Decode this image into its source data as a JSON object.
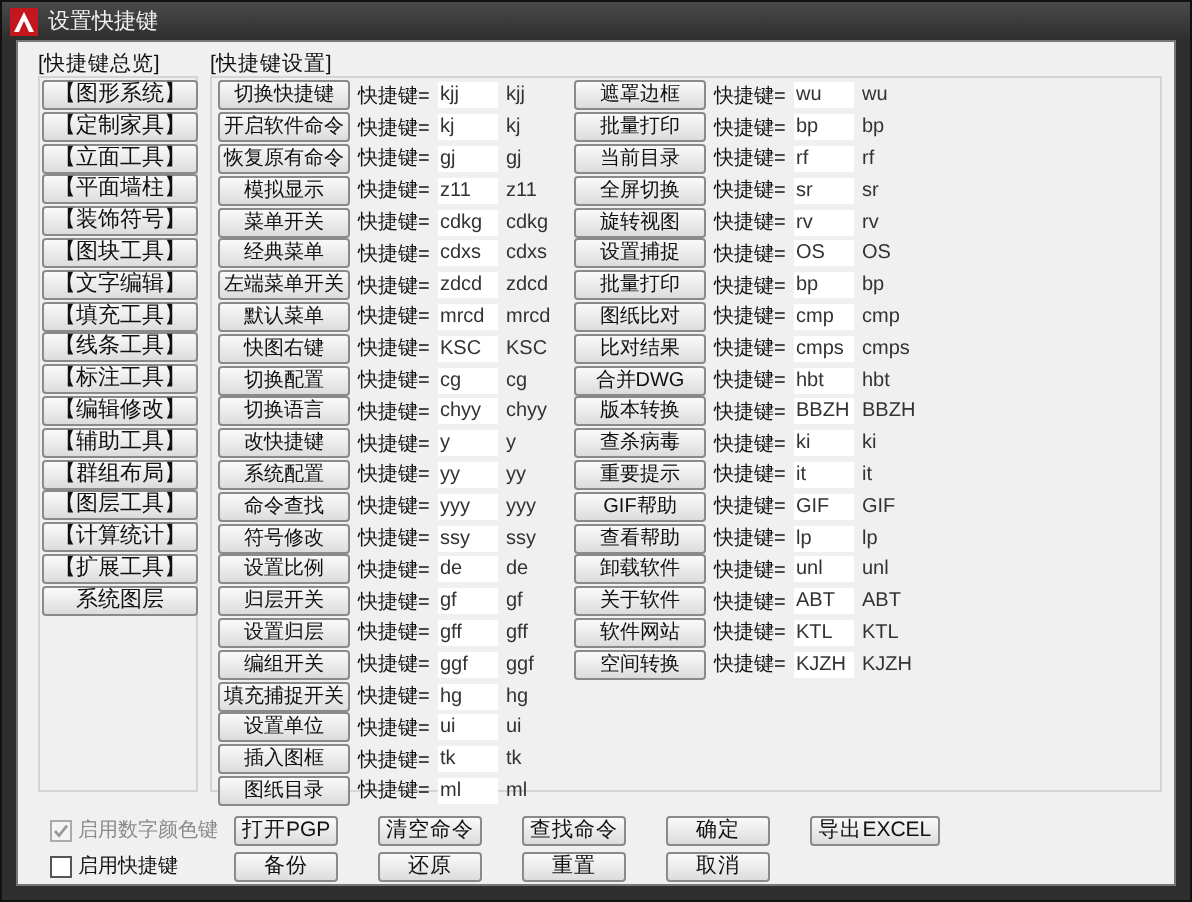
{
  "window": {
    "title": "设置快捷键"
  },
  "overview": {
    "title": "[快捷键总览]",
    "items": [
      {
        "label": "【图形系统】"
      },
      {
        "label": "【定制家具】"
      },
      {
        "label": "【立面工具】"
      },
      {
        "label": "【平面墙柱】"
      },
      {
        "label": "【装饰符号】"
      },
      {
        "label": "【图块工具】"
      },
      {
        "label": "【文字编辑】"
      },
      {
        "label": "【填充工具】"
      },
      {
        "label": "【线条工具】"
      },
      {
        "label": "【标注工具】"
      },
      {
        "label": "【编辑修改】"
      },
      {
        "label": "【辅助工具】"
      },
      {
        "label": "【群组布局】"
      },
      {
        "label": "【图层工具】"
      },
      {
        "label": "【计算统计】"
      },
      {
        "label": "【扩展工具】"
      },
      {
        "label": "系统图层"
      }
    ]
  },
  "settings": {
    "title": "[快捷键设置]",
    "columns": [
      [
        {
          "button": "切换快捷键",
          "label": "快捷键=",
          "value": "kjj",
          "shortcut": "kjj"
        },
        {
          "button": "开启软件命令",
          "label": "快捷键=",
          "value": "kj",
          "shortcut": "kj"
        },
        {
          "button": "恢复原有命令",
          "label": "快捷键=",
          "value": "gj",
          "shortcut": "gj"
        },
        {
          "button": "模拟显示",
          "label": "快捷键=",
          "value": "z11",
          "shortcut": "z11"
        },
        {
          "button": "菜单开关",
          "label": "快捷键=",
          "value": "cdkg",
          "shortcut": "cdkg"
        },
        {
          "button": "经典菜单",
          "label": "快捷键=",
          "value": "cdxs",
          "shortcut": "cdxs"
        },
        {
          "button": "左端菜单开关",
          "label": "快捷键=",
          "value": "zdcd",
          "shortcut": "zdcd"
        },
        {
          "button": "默认菜单",
          "label": "快捷键=",
          "value": "mrcd",
          "shortcut": "mrcd"
        },
        {
          "button": "快图右键",
          "label": "快捷键=",
          "value": "KSC",
          "shortcut": "KSC"
        },
        {
          "button": "切换配置",
          "label": "快捷键=",
          "value": "cg",
          "shortcut": "cg"
        },
        {
          "button": "切换语言",
          "label": "快捷键=",
          "value": "chyy",
          "shortcut": "chyy"
        },
        {
          "button": "改快捷键",
          "label": "快捷键=",
          "value": "y",
          "shortcut": "y"
        },
        {
          "button": "系统配置",
          "label": "快捷键=",
          "value": "yy",
          "shortcut": "yy"
        },
        {
          "button": "命令查找",
          "label": "快捷键=",
          "value": "yyy",
          "shortcut": "yyy"
        },
        {
          "button": "符号修改",
          "label": "快捷键=",
          "value": "ssy",
          "shortcut": "ssy"
        },
        {
          "button": "设置比例",
          "label": "快捷键=",
          "value": "de",
          "shortcut": "de"
        },
        {
          "button": "归层开关",
          "label": "快捷键=",
          "value": "gf",
          "shortcut": "gf"
        },
        {
          "button": "设置归层",
          "label": "快捷键=",
          "value": "gff",
          "shortcut": "gff"
        },
        {
          "button": "编组开关",
          "label": "快捷键=",
          "value": "ggf",
          "shortcut": "ggf"
        },
        {
          "button": "填充捕捉开关",
          "label": "快捷键=",
          "value": "hg",
          "shortcut": "hg"
        },
        {
          "button": "设置单位",
          "label": "快捷键=",
          "value": "ui",
          "shortcut": "ui"
        },
        {
          "button": "插入图框",
          "label": "快捷键=",
          "value": "tk",
          "shortcut": "tk"
        },
        {
          "button": "图纸目录",
          "label": "快捷键=",
          "value": "ml",
          "shortcut": "ml"
        }
      ],
      [
        {
          "button": "遮罩边框",
          "label": "快捷键=",
          "value": "wu",
          "shortcut": "wu"
        },
        {
          "button": "批量打印",
          "label": "快捷键=",
          "value": "bp",
          "shortcut": "bp"
        },
        {
          "button": "当前目录",
          "label": "快捷键=",
          "value": "rf",
          "shortcut": "rf"
        },
        {
          "button": "全屏切换",
          "label": "快捷键=",
          "value": "sr",
          "shortcut": "sr"
        },
        {
          "button": "旋转视图",
          "label": "快捷键=",
          "value": "rv",
          "shortcut": "rv"
        },
        {
          "button": "设置捕捉",
          "label": "快捷键=",
          "value": "OS",
          "shortcut": "OS"
        },
        {
          "button": "批量打印",
          "label": "快捷键=",
          "value": "bp",
          "shortcut": "bp"
        },
        {
          "button": "图纸比对",
          "label": "快捷键=",
          "value": "cmp",
          "shortcut": "cmp"
        },
        {
          "button": "比对结果",
          "label": "快捷键=",
          "value": "cmps",
          "shortcut": "cmps"
        },
        {
          "button": "合并DWG",
          "label": "快捷键=",
          "value": "hbt",
          "shortcut": "hbt"
        },
        {
          "button": "版本转换",
          "label": "快捷键=",
          "value": "BBZH",
          "shortcut": "BBZH"
        },
        {
          "button": "查杀病毒",
          "label": "快捷键=",
          "value": "ki",
          "shortcut": "ki"
        },
        {
          "button": "重要提示",
          "label": "快捷键=",
          "value": "it",
          "shortcut": "it"
        },
        {
          "button": "GIF帮助",
          "label": "快捷键=",
          "value": "GIF",
          "shortcut": "GIF"
        },
        {
          "button": "查看帮助",
          "label": "快捷键=",
          "value": "lp",
          "shortcut": "lp"
        },
        {
          "button": "卸载软件",
          "label": "快捷键=",
          "value": "unl",
          "shortcut": "unl"
        },
        {
          "button": "关于软件",
          "label": "快捷键=",
          "value": "ABT",
          "shortcut": "ABT"
        },
        {
          "button": "软件网站",
          "label": "快捷键=",
          "value": "KTL",
          "shortcut": "KTL"
        },
        {
          "button": "空间转换",
          "label": "快捷键=",
          "value": "KJZH",
          "shortcut": "KJZH"
        }
      ]
    ]
  },
  "options": [
    {
      "label": "启用数字颜色键",
      "checked": true,
      "disabled": true
    },
    {
      "label": "启用快捷键",
      "checked": false,
      "disabled": false
    }
  ],
  "buttons": [
    [
      "打开PGP",
      "清空命令",
      "查找命令",
      "确定",
      "导出EXCEL"
    ],
    [
      "备份",
      "还原",
      "重置",
      "取消"
    ]
  ]
}
